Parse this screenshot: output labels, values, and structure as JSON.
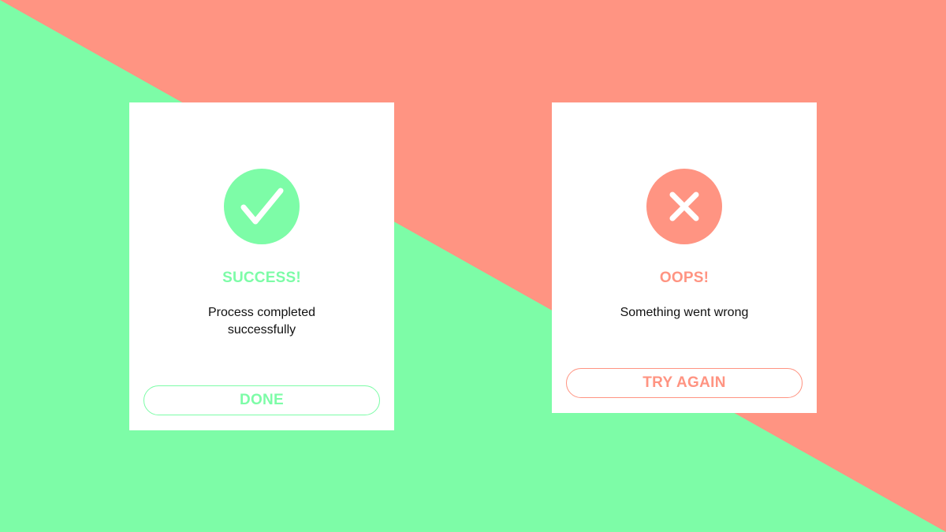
{
  "colors": {
    "success": "#7dfca7",
    "error": "#ff9482",
    "card_background": "#ffffff",
    "message_text": "#111111"
  },
  "success_card": {
    "icon": "checkmark-icon",
    "title": "SUCCESS!",
    "message": "Process completed successfully",
    "button_label": "DONE"
  },
  "error_card": {
    "icon": "close-icon",
    "title": "OOPS!",
    "message": "Something went wrong",
    "button_label": "TRY AGAIN"
  }
}
